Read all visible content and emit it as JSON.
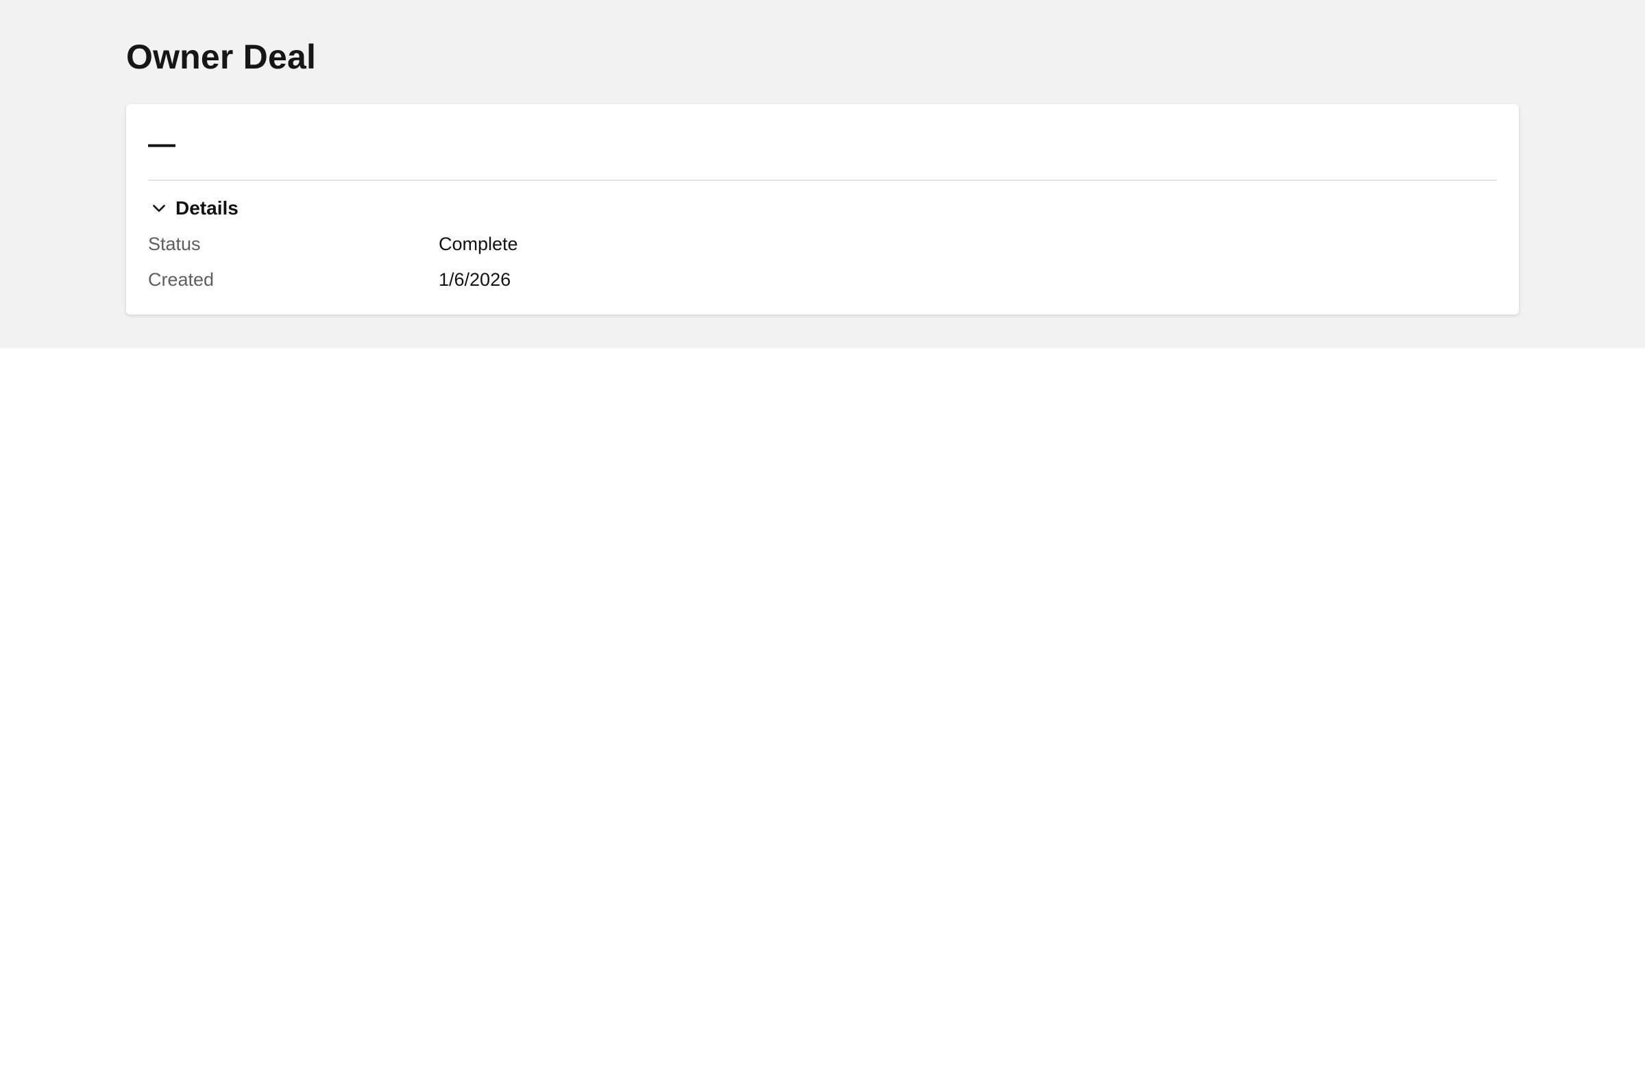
{
  "page": {
    "title": "Owner Deal"
  },
  "record": {
    "name": "—",
    "section": {
      "label": "Details",
      "expanded": true,
      "toggle_icon": "chevron-down-icon"
    },
    "fields": [
      {
        "label": "Status",
        "value": "Complete"
      },
      {
        "label": "Created",
        "value": "1/6/2026"
      }
    ]
  },
  "colors": {
    "header_band": "#f2f2f2",
    "card_background": "#ffffff",
    "label_text": "#5e5e5e",
    "value_text": "#111111",
    "divider": "#e3e3e3"
  }
}
